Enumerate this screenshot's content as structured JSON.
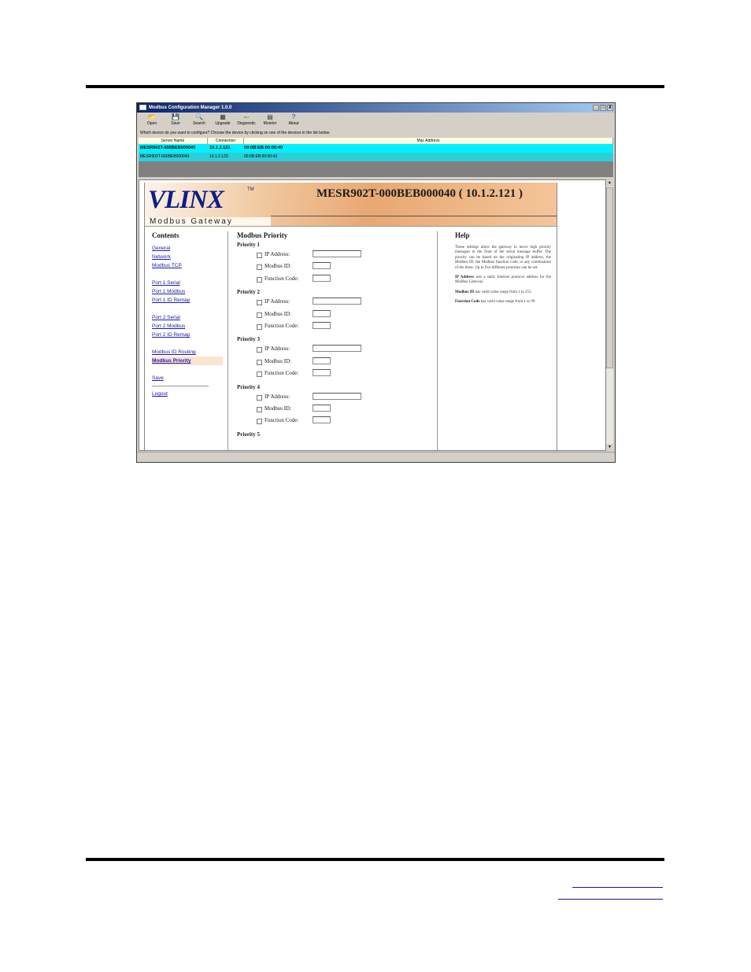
{
  "window": {
    "title": "Modbus Configuration Manager 1.0.0",
    "controls": [
      "_",
      "□",
      "X"
    ]
  },
  "toolbar": [
    {
      "label": "Open",
      "icon": "open-folder-icon",
      "glyph": "📂"
    },
    {
      "label": "Save",
      "icon": "save-disk-icon",
      "glyph": "💾"
    },
    {
      "label": "Search",
      "icon": "search-icon",
      "glyph": "🔍"
    },
    {
      "label": "Upgrade",
      "icon": "upgrade-icon",
      "glyph": "▦"
    },
    {
      "label": "Diagnostic",
      "icon": "diagnostic-icon",
      "glyph": "ʙɢᴛ"
    },
    {
      "label": "Monitor",
      "icon": "monitor-icon",
      "glyph": "▤"
    },
    {
      "label": "About",
      "icon": "help-icon",
      "glyph": "?"
    }
  ],
  "prompt": "Which device do you want to configure? Choose the device by clicking on one of the devices in the list below.",
  "device_table": {
    "headers": [
      "Server Name",
      "Connection",
      "Mac Address"
    ],
    "rows": [
      {
        "name": "MESR902T-000BEB000040",
        "connection": "10.1.2.121",
        "mac": "00:0B:EB:00:00:40"
      },
      {
        "name": "MESR902T-000BEB000043",
        "connection": "10.1.2.123",
        "mac": "00:0B:EB:00:00:43"
      }
    ]
  },
  "banner": {
    "logo_main": "VLINX",
    "logo_tm": "TM",
    "logo_sub": "Modbus Gateway",
    "device_title": "MESR902T-000BEB000040 ( 10.1.2.121 )"
  },
  "contents": {
    "title": "Contents",
    "group1": [
      "General",
      "Network",
      "Modbus TCP"
    ],
    "group2": [
      "Port 1 Serial",
      "Port 1 Modbus",
      "Port 1 ID Remap"
    ],
    "group3": [
      "Port 2 Serial",
      "Port 2 Modbus",
      "Port 2 ID Remap"
    ],
    "group4": [
      "Modbus ID Routing",
      "Modbus Priority"
    ],
    "save": "Save",
    "logout": "Logout"
  },
  "priority": {
    "title": "Modbus Priority",
    "field_labels": {
      "ip": "IP Address:",
      "modbus": "Modbus ID:",
      "function": "Function Code:"
    },
    "groups": [
      "Priority 1",
      "Priority 2",
      "Priority 3",
      "Priority 4",
      "Priority 5"
    ]
  },
  "help": {
    "title": "Help",
    "intro": "These settings allow the gateway to move high priority messages to the front of the serial message buffer. The priority can be based on the originating IP address, the Modbus ID, the Modbus function code, or any combination of the three. Up to five different priorities can be set.",
    "ip_term": "IP Address",
    "ip_desc": " sets a static Internet protocol address for the Modbus Gateway.",
    "modbus_term": "Modbus ID",
    "modbus_desc": " has valid value range from 1 to 255.",
    "function_term": "Function Code",
    "function_desc": " has valid value range from 1 to 99."
  }
}
